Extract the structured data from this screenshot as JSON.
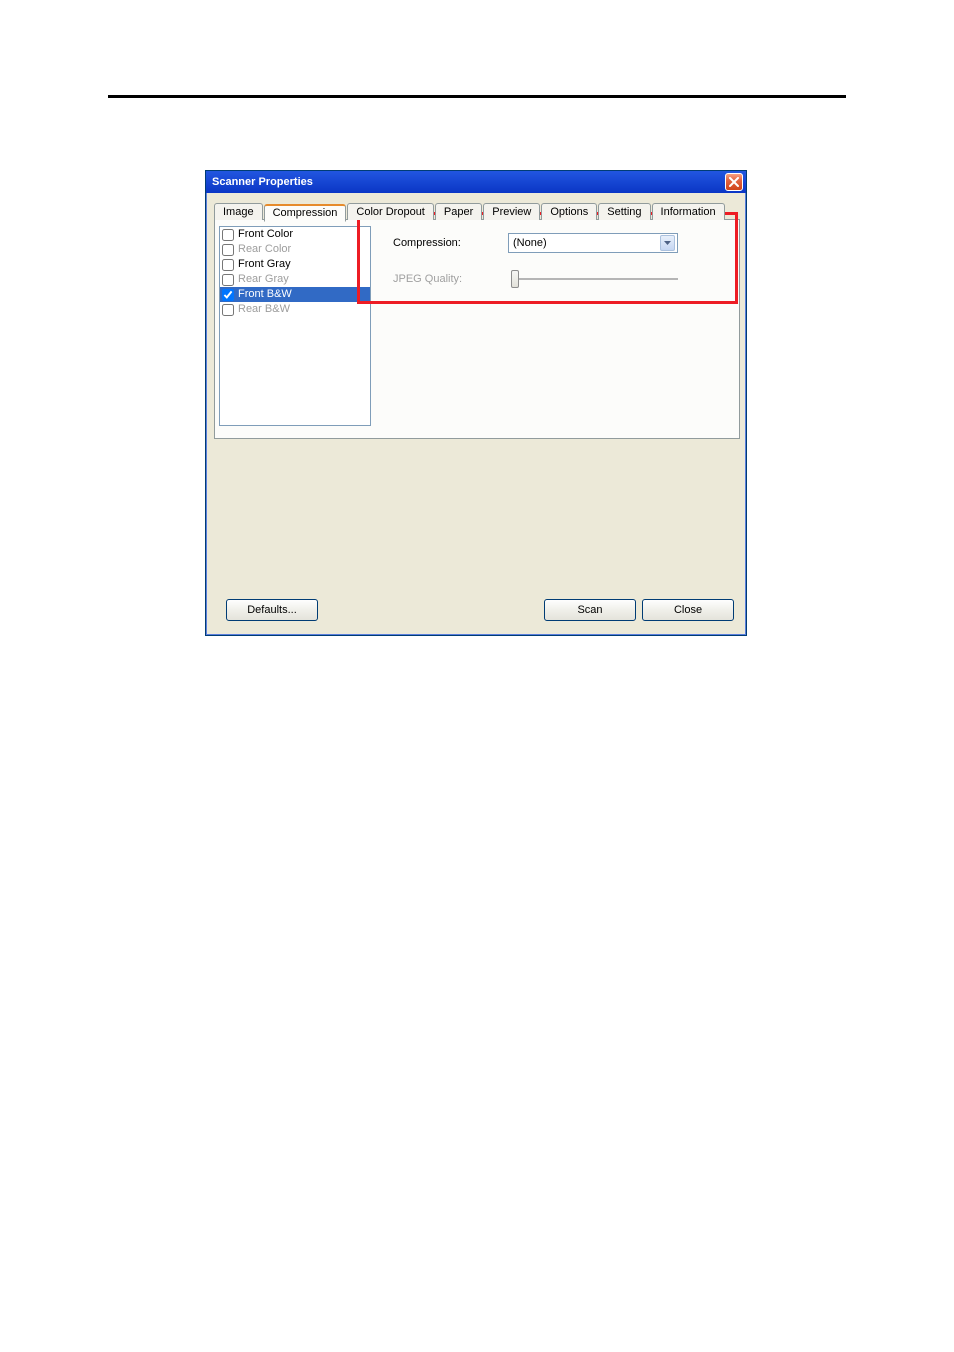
{
  "dialog": {
    "title": "Scanner Properties"
  },
  "tabs": [
    {
      "label": "Image"
    },
    {
      "label": "Compression"
    },
    {
      "label": "Color Dropout"
    },
    {
      "label": "Paper"
    },
    {
      "label": "Preview"
    },
    {
      "label": "Options"
    },
    {
      "label": "Setting"
    },
    {
      "label": "Information"
    }
  ],
  "active_tab_index": 1,
  "source_list": [
    {
      "label": "Front Color",
      "checked": false,
      "disabled": false,
      "selected": false
    },
    {
      "label": "Rear Color",
      "checked": false,
      "disabled": true,
      "selected": false
    },
    {
      "label": "Front Gray",
      "checked": false,
      "disabled": false,
      "selected": false
    },
    {
      "label": "Rear Gray",
      "checked": false,
      "disabled": true,
      "selected": false
    },
    {
      "label": "Front B&W",
      "checked": true,
      "disabled": false,
      "selected": true
    },
    {
      "label": "Rear B&W",
      "checked": false,
      "disabled": true,
      "selected": false
    }
  ],
  "compression": {
    "label": "Compression:",
    "value": "(None)"
  },
  "jpeg_quality": {
    "label": "JPEG Quality:",
    "enabled": false
  },
  "buttons": {
    "defaults": "Defaults...",
    "scan": "Scan",
    "close": "Close"
  }
}
